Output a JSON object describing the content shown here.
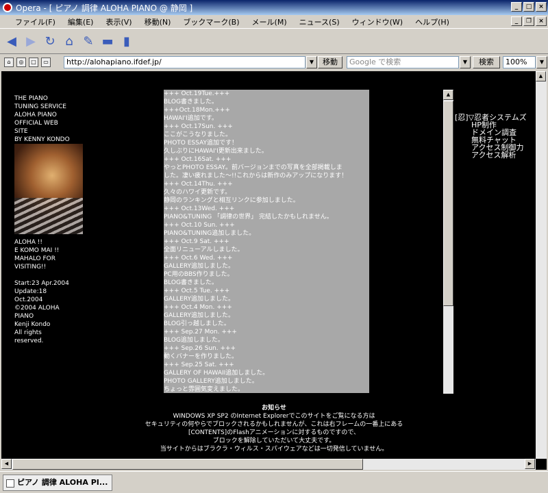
{
  "window": {
    "title": "Opera - [ ピアノ 調律 ALOHA PIANO @ 静岡 ]"
  },
  "menu": [
    "ファイル(F)",
    "編集(E)",
    "表示(V)",
    "移動(N)",
    "ブックマーク(B)",
    "メール(M)",
    "ニュース(S)",
    "ウィンドウ(W)",
    "ヘルプ(H)"
  ],
  "address": {
    "url": "http://alohapiano.ifdef.jp/",
    "go_label": "移動"
  },
  "search": {
    "placeholder": "Google で検索",
    "button": "検索"
  },
  "zoom": "100%",
  "left": {
    "intro": "THE PIANO\nTUNING SERVICE\nALOHA PIANO\nOFFICIAL WEB\nSITE\nBY KENNY KONDO",
    "greeting": "ALOHA !!\nE KOMO MAI !!\nMAHALO FOR\nVISITING!!",
    "info": "Start:23 Apr.2004\nUpdate:18\nOct.2004\n©2004 ALOHA\nPIANO\nKenji Kondo\nAll rights\nreserved."
  },
  "news": [
    "+++ Oct.19Tue.+++",
    "  BLOG書きました。",
    "+++Oct.18Mon.+++",
    "HAWAI'I追加です。",
    "+++ Oct.17Sun. +++",
    "  ここがこうなりました。",
    "  PHOTO ESSAY追加です！",
    "  久しぶりにHAWAI'I更新出来ました。",
    "+++ Oct.16Sat. +++",
    "  やっとPHOTO ESSAY。前バージョンまでの写真を全部掲載しま",
    "した。凄い疲れました～!!これからは新作のみアップになります！",
    "+++ Oct.14Thu. +++",
    "  久々のハワイ更新です。",
    "  静岡のランキングと相互リンクに参加しました。",
    "+++ Oct.13Wed. +++",
    "  PIANO&TUNING 「調律の世界」 完結したかもしれません。",
    "+++ Oct.10 Sun. +++",
    "  PIANO&TUNING追加しました。",
    "+++ Oct.9 Sat. +++",
    "  全面リニューアルしました。",
    "+++ Oct.6 Wed. +++",
    "  GALLERY追加しました。",
    "  PC用のBBS作りました。",
    "  BLOG書きました。",
    "+++ Oct.5 Tue. +++",
    "  GALLERY追加しました。",
    "+++ Oct.4 Mon. +++",
    "  GALLERY追加しました。",
    "  BLOG引っ越しました。",
    "+++ Sep.27 Mon. +++",
    "  BLOG追加しました。",
    "+++ Sep.26 Sun. +++",
    "  動くバナーを作りました。",
    "+++ Sep.25 Sat. +++",
    "  GALLERY OF HAWAII追加しました。",
    "  PHOTO GALLERY追加しました。",
    "  ちょっと雰囲気変えました。"
  ],
  "ninja": {
    "root": "[忍]▽忍者システムズ",
    "items": [
      "HP制作",
      "ドメイン調査",
      "無料チャット",
      "アクセス制御力",
      "アクセス解析"
    ]
  },
  "notice": {
    "title": "お知らせ",
    "lines": [
      "WINDOWS XP SP2 のInternet Explorerでこのサイトをご覧になる方は",
      "セキュリティの何やらでブロックされるかもしれませんが、これは右フレームの一番上にある",
      "[CONTENTS]のFlashアニメーションに対するものですので、",
      "ブロックを解除していただいて大丈夫です。",
      "当サイトからはブラクラ・ウィルス・スパイウェアなどは一切発信していません。"
    ]
  },
  "tab": {
    "title": "ピアノ 調律 ALOHA PI..."
  }
}
